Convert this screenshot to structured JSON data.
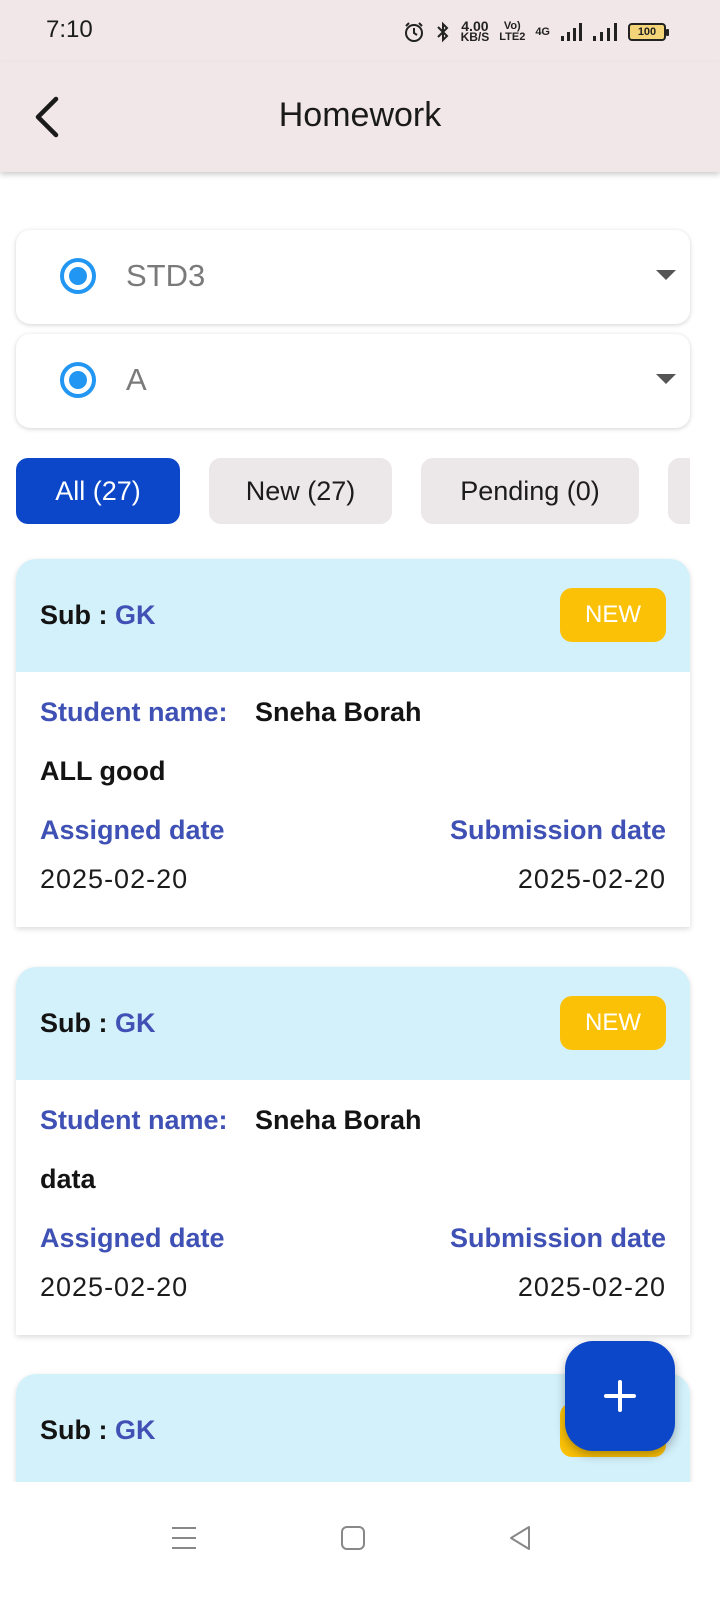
{
  "status_bar": {
    "time": "7:10",
    "speed_value": "4.00",
    "speed_unit": "KB/S",
    "volte": "Vo)",
    "lte": "LTE2",
    "network": "4G",
    "battery": "100",
    "icons": [
      "alarm-icon",
      "bluetooth-icon",
      "signal-icon",
      "signal-icon",
      "battery-icon"
    ]
  },
  "app_bar": {
    "title": "Homework",
    "back_icon": "back-arrow-icon"
  },
  "filters": {
    "class_value": "STD3",
    "section_value": "A"
  },
  "tabs": [
    {
      "label": "All (27)",
      "active": true
    },
    {
      "label": "New (27)",
      "active": false
    },
    {
      "label": "Pending (0)",
      "active": false
    },
    {
      "label": "",
      "active": false
    }
  ],
  "cards": [
    {
      "sub_label": "Sub :",
      "subject": "GK",
      "badge": "NEW",
      "student_label": "Student name:",
      "student_name": "Sneha Borah",
      "description": "ALL good",
      "assigned_label": "Assigned date",
      "submission_label": "Submission date",
      "assigned_date": "2025-02-20",
      "submission_date": "2025-02-20"
    },
    {
      "sub_label": "Sub :",
      "subject": "GK",
      "badge": "NEW",
      "student_label": "Student name:",
      "student_name": "Sneha Borah",
      "description": "data",
      "assigned_label": "Assigned date",
      "submission_label": "Submission date",
      "assigned_date": "2025-02-20",
      "submission_date": "2025-02-20"
    },
    {
      "sub_label": "Sub :",
      "subject": "GK",
      "badge": "NEW"
    }
  ],
  "fab": {
    "icon": "plus-icon"
  },
  "colors": {
    "primary": "#0d47c9",
    "accent_blue": "#3f51b5",
    "radio": "#2196f3",
    "badge": "#fbc107",
    "card_header": "#d3f1fb",
    "app_bar": "#f1e6e8"
  }
}
